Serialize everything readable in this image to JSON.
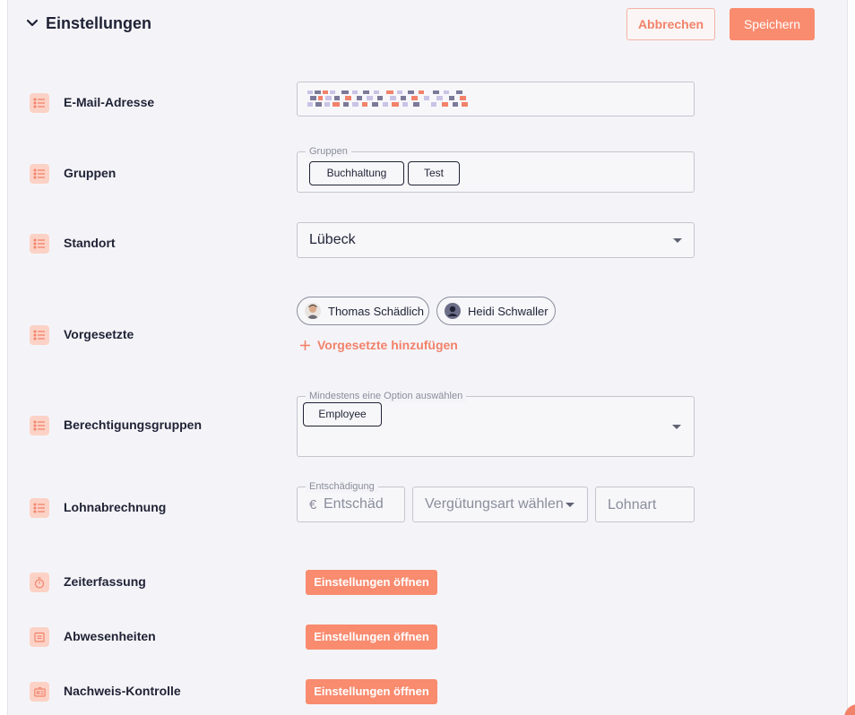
{
  "header": {
    "title": "Einstellungen",
    "cancel_label": "Abbrechen",
    "save_label": "Speichern"
  },
  "fields": {
    "email": {
      "label": "E-Mail-Adresse"
    },
    "groups": {
      "label": "Gruppen",
      "legend": "Gruppen",
      "chips": [
        "Buchhaltung",
        "Test"
      ]
    },
    "location": {
      "label": "Standort",
      "value": "Lübeck"
    },
    "supervisors": {
      "label": "Vorgesetzte",
      "people": [
        "Thomas Schädlich",
        "Heidi Schwaller"
      ],
      "add_label": "Vorgesetzte hinzufügen"
    },
    "permissions": {
      "label": "Berechtigungsgruppen",
      "legend": "Mindestens eine Option auswählen",
      "chips": [
        "Employee"
      ]
    },
    "payroll": {
      "label": "Lohnabrechnung",
      "compensation_legend": "Entschädigung",
      "currency": "€",
      "compensation_placeholder": "Entschäd",
      "compensation_type_placeholder": "Vergütungsart wählen",
      "wage_type_placeholder": "Lohnart"
    }
  },
  "settings_rows": [
    {
      "label": "Zeiterfassung",
      "button": "Einstellungen öffnen",
      "icon": "stopwatch-icon"
    },
    {
      "label": "Abwesenheiten",
      "button": "Einstellungen öffnen",
      "icon": "calendar-icon"
    },
    {
      "label": "Nachweis-Kontrolle",
      "button": "Einstellungen öffnen",
      "icon": "id-card-icon"
    }
  ],
  "colors": {
    "accent": "#f98b6f",
    "accent_text": "#f2826a",
    "icon_bg": "#fcd2c6",
    "text": "#1f2235",
    "panel_bg": "#f4f4f8"
  }
}
